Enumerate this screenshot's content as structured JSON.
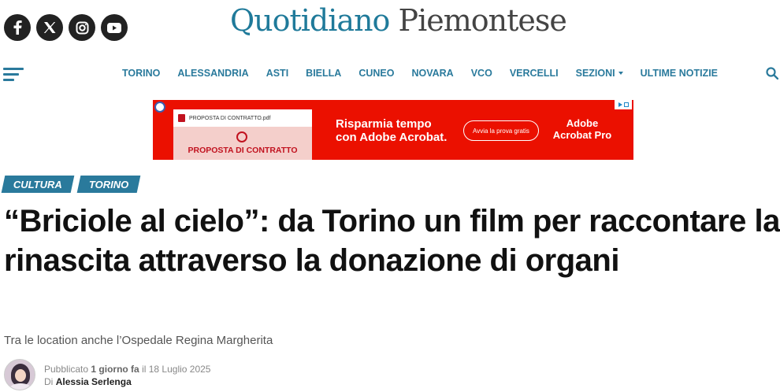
{
  "header": {
    "social": [
      {
        "name": "facebook-icon"
      },
      {
        "name": "x-icon"
      },
      {
        "name": "instagram-icon"
      },
      {
        "name": "youtube-icon"
      }
    ],
    "logo_part1": "Quotidiano",
    "logo_part2": "Piemontese"
  },
  "nav": {
    "items": [
      "TORINO",
      "ALESSANDRIA",
      "ASTI",
      "BIELLA",
      "CUNEO",
      "NOVARA",
      "VCO",
      "VERCELLI",
      "SEZIONI",
      "ULTIME NOTIZIE"
    ]
  },
  "ad": {
    "doc_filename": "PROPOSTA DI CONTRATTO.pdf",
    "doc_label": "PROPOSTA DI CONTRATTO",
    "headline_line1": "Risparmia tempo",
    "headline_line2": "con Adobe Acrobat.",
    "cta": "Avvia la prova gratis",
    "brand_line1": "Adobe",
    "brand_line2": "Acrobat Pro"
  },
  "article": {
    "tags": [
      "CULTURA",
      "TORINO"
    ],
    "title": "“Briciole al cielo”: da Torino un film per raccontare la rinascita attraverso la donazione di organi",
    "subtitle": "Tra le location anche l’Ospedale Regina Margherita",
    "published_prefix": "Pubblicato",
    "published_time": "1 giorno fa",
    "published_on": "il 18 Luglio 2025",
    "by_prefix": "Di",
    "author": "Alessia Serlenga"
  },
  "colors": {
    "brand": "#2a7a9c",
    "ad_red": "#eb1000"
  }
}
